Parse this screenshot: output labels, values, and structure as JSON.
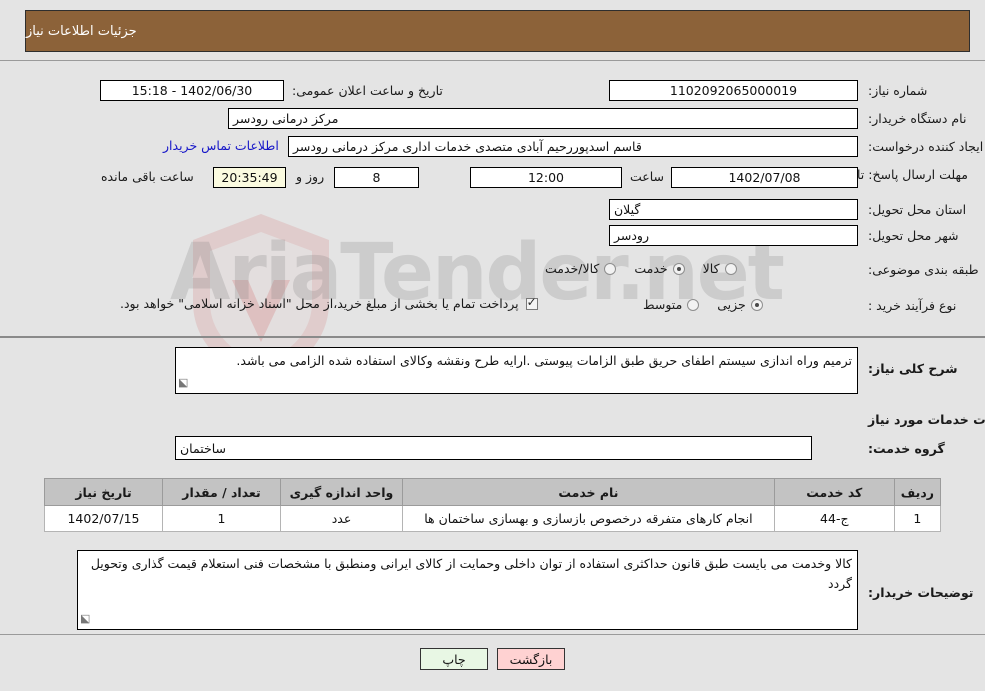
{
  "header": {
    "title": "جزئیات اطلاعات نیاز"
  },
  "watermark": {
    "text": "AriaTender.net"
  },
  "fields": {
    "need_number": {
      "label": "شماره نیاز:",
      "value": "1102092065000019"
    },
    "public_announce": {
      "label": "تاریخ و ساعت اعلان عمومی:",
      "value": "15:18 - 1402/06/30"
    },
    "buyer_org": {
      "label": "نام دستگاه خریدار:",
      "value": "مرکز درمانی رودسر"
    },
    "request_creator": {
      "label": "ایجاد کننده درخواست:",
      "value": "قاسم اسدپوررحیم آبادی متصدی خدمات اداری مرکز درمانی رودسر"
    },
    "contact_link": {
      "label": "اطلاعات تماس خریدار"
    },
    "deadline": {
      "label": "مهلت ارسال پاسخ: تا تاریخ:",
      "date": "1402/07/08",
      "time_label": "ساعت",
      "time": "12:00",
      "days": "8",
      "days_label": "روز و",
      "countdown": "20:35:49",
      "countdown_label": "ساعت باقی مانده"
    },
    "delivery_province": {
      "label": "استان محل تحویل:",
      "value": "گیلان"
    },
    "delivery_city": {
      "label": "شهر محل تحویل:",
      "value": "رودسر"
    },
    "subject_category": {
      "label": "طبقه بندی موضوعی:",
      "options": [
        {
          "label": "کالا",
          "selected": false
        },
        {
          "label": "خدمت",
          "selected": true
        },
        {
          "label": "کالا/خدمت",
          "selected": false
        }
      ]
    },
    "purchase_type": {
      "label": "نوع فرآیند خرید :",
      "options": [
        {
          "label": "جزیی",
          "selected": true
        },
        {
          "label": "متوسط",
          "selected": false
        }
      ],
      "treasury_checked": true,
      "treasury_note": "پرداخت تمام یا بخشی از مبلغ خرید،از محل \"اسناد خزانه اسلامی\" خواهد بود."
    },
    "general_description": {
      "label": "شرح کلی نیاز:",
      "value": "ترمیم وراه اندازی سیستم اطفای حریق طبق الزامات پیوستی .ارایه طرح ونقشه وکالای استفاده شده الزامی می باشد."
    },
    "services_info_heading": "اطلاعات خدمات مورد نیاز",
    "service_group": {
      "label": "گروه خدمت:",
      "value": "ساختمان"
    },
    "buyer_comments": {
      "label": "توضیحات خریدار:",
      "value": "کالا وخدمت می بایست طبق قانون حداکثری استفاده از توان داخلی وحمایت از کالای ایرانی ومنطبق با مشخصات فنی استعلام قیمت گذاری وتحویل گردد"
    }
  },
  "table": {
    "headers": [
      "ردیف",
      "کد خدمت",
      "نام خدمت",
      "واحد اندازه گیری",
      "تعداد / مقدار",
      "تاریخ نیاز"
    ],
    "rows": [
      {
        "index": "1",
        "service_code": "ج-44",
        "service_name": "انجام کارهای متفرقه درخصوص بازسازی و بهسازی ساختمان ها",
        "unit": "عدد",
        "quantity": "1",
        "need_date": "1402/07/15"
      }
    ]
  },
  "buttons": {
    "back": "بازگشت",
    "print": "چاپ"
  },
  "colors": {
    "header_brown": "#8c6239",
    "back_button": "#ffd2d2",
    "print_button": "#e8f7e4",
    "countdown_bg": "#fbfbe0",
    "link_blue": "#1616c8"
  }
}
